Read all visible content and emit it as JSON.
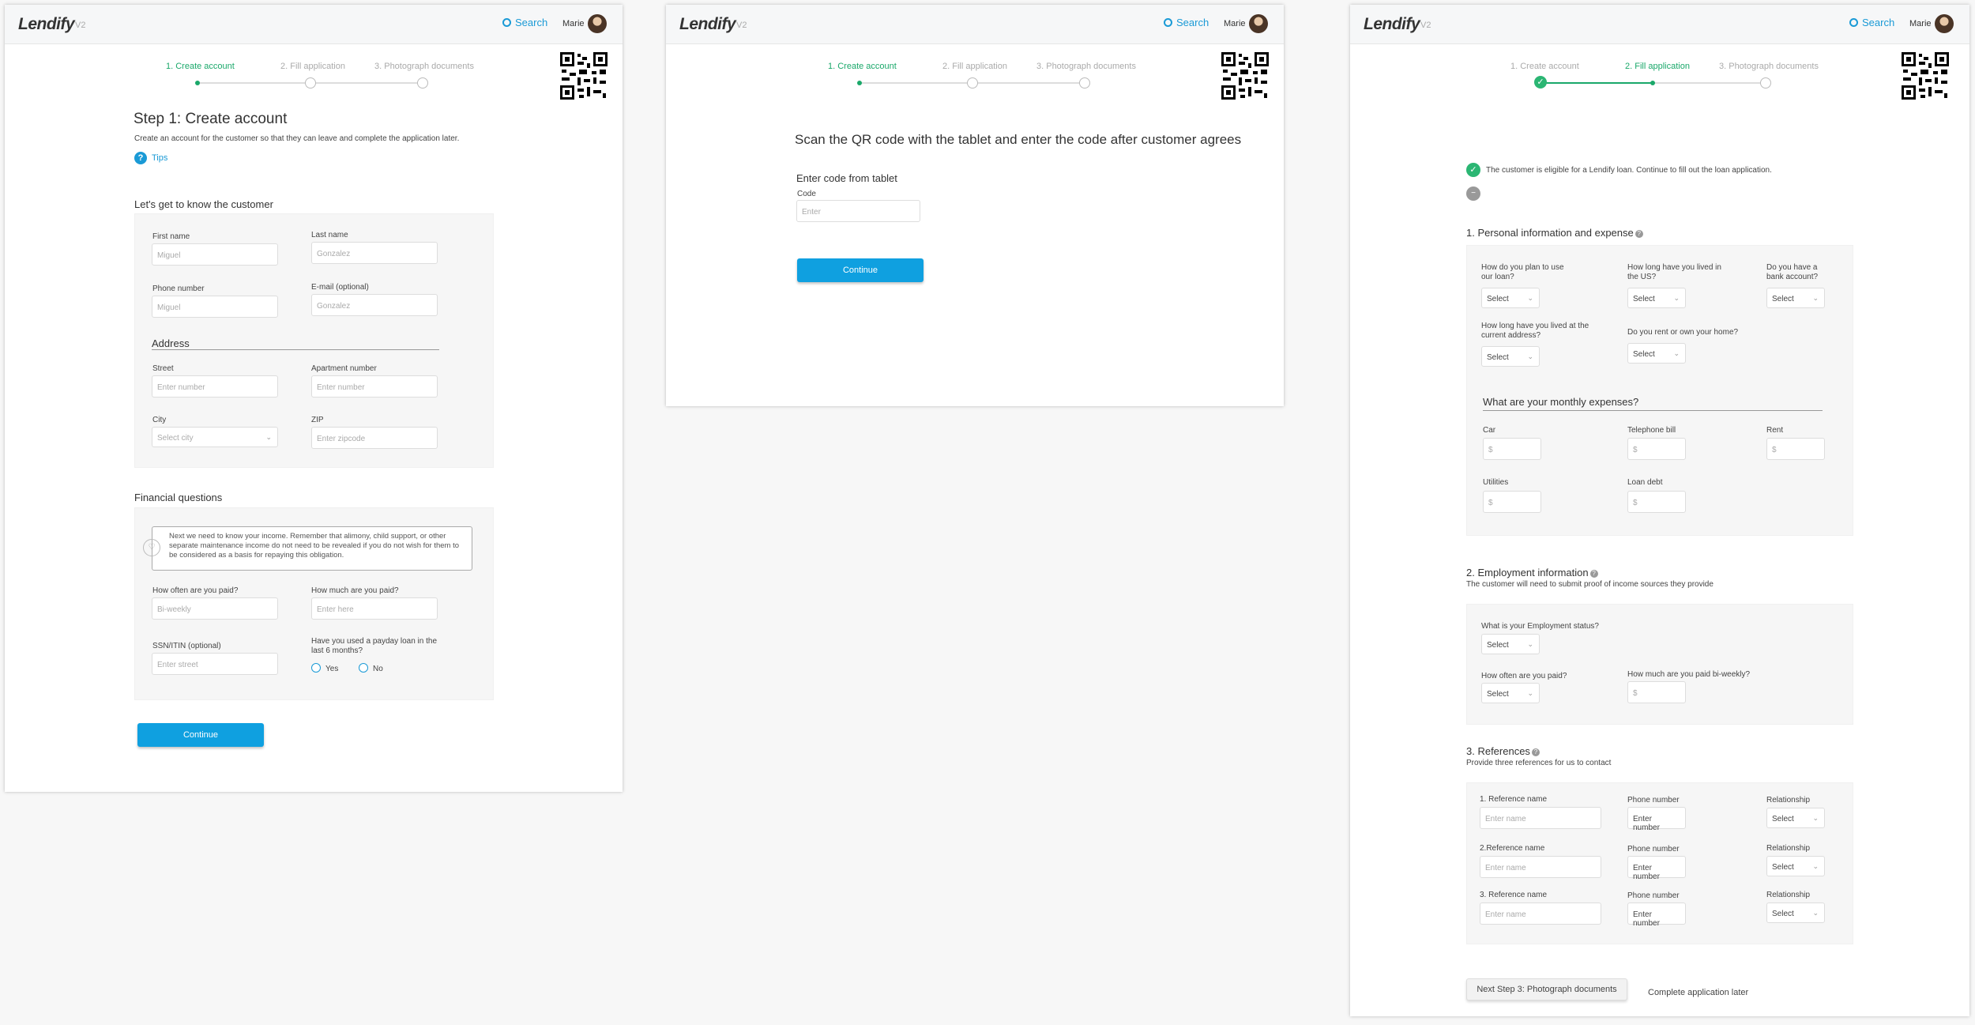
{
  "app": {
    "logo": "Lendify",
    "version": "V2",
    "search_label": "Search",
    "user_name": "Marie"
  },
  "steps": [
    "1. Create account",
    "2. Fill application",
    "3. Photograph documents"
  ],
  "p1": {
    "title": "Step 1: Create account",
    "subtitle": "Create an account for the customer so that they can leave and complete the application later.",
    "tips": "Tips",
    "know_title": "Let's get to know the customer",
    "first_name_label": "First name",
    "first_name_value": "Miguel",
    "last_name_label": "Last  name",
    "last_name_value": "Gonzalez",
    "phone_label": "Phone number",
    "phone_value": "Miguel",
    "email_label": "E-mail (optional)",
    "email_value": "Gonzalez",
    "address_title": "Address",
    "street_label": "Street",
    "street_ph": "Enter number",
    "apt_label": "Apartment number",
    "apt_ph": "Enter number",
    "city_label": "City",
    "city_ph": "Select city",
    "zip_label": "ZIP",
    "zip_ph": "Enter zipcode",
    "fin_title": "Financial questions",
    "info_text": "Next we need to know your income. Remember that alimony, child support, or other separate maintenance income do not need to be revealed if you do not wish for them to be considered as a basis for repaying this obligation.",
    "often_label": "How often are you paid?",
    "often_value": "Bi-weekly",
    "much_label": "How much are you paid?",
    "much_ph": "Enter here",
    "ssn_label": "SSN/ITIN (optional)",
    "ssn_ph": "Enter street",
    "payday_label": "Have you used a payday loan in the last 6 months?",
    "yes": "Yes",
    "no": "No",
    "continue": "Continue"
  },
  "p2": {
    "title": "Scan the QR code with the tablet and enter the code after customer agrees",
    "code_title": "Enter code from tablet",
    "code_label": "Code",
    "code_ph": "Enter",
    "continue": "Continue"
  },
  "p3": {
    "eligible": "The customer is eligible for a Lendify loan. Continue to fill out the loan application.",
    "sec1": "1.  Personal information and expense",
    "q_use": "How do you plan to use our loan?",
    "q_us": "How long have you lived in the US?",
    "q_bank": "Do you have a bank account?",
    "q_addr": "How long have you lived at the current address?",
    "q_rent": "Do you rent or own your home?",
    "select": "Select",
    "monthly_title": "What are your monthly expenses?",
    "car": "Car",
    "tel": "Telephone bill",
    "rent": "Rent",
    "util": "Utilities",
    "loan": "Loan debt",
    "dollar": "$",
    "sec2": "2. Employment information",
    "sec2_sub": "The customer will need to submit proof of income sources they provide",
    "q_emp": "What is your Employment status?",
    "q_often": "How often are you paid?",
    "q_much": "How much are you paid bi-weekly?",
    "sec3": "3. References",
    "sec3_sub": "Provide three references for us to contact",
    "ref1": "1. Reference name",
    "ref2": "2.Reference name",
    "ref3": "3. Reference name",
    "phone": "Phone number",
    "rel": "Relationship",
    "enter_name": "Enter name",
    "enter_number": "Enter number",
    "next": "Next Step 3: Photograph documents",
    "later": "Complete application later"
  }
}
